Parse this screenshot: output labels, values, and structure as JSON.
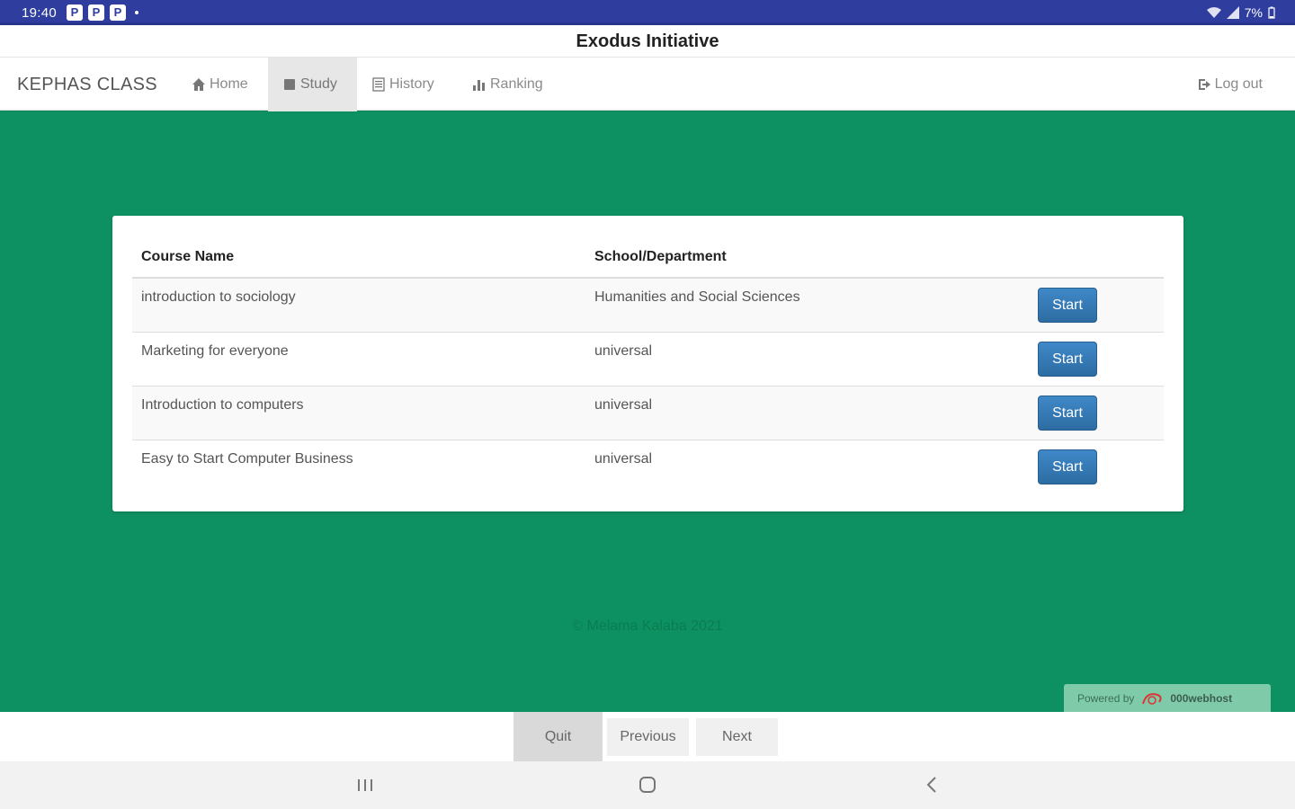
{
  "status_bar": {
    "time": "19:40",
    "badges": [
      "P",
      "P",
      "P"
    ],
    "battery": "7%"
  },
  "app_bar": {
    "title": "Exodus Initiative"
  },
  "navbar": {
    "brand": "KEPHAS CLASS",
    "items": [
      {
        "label": "Home",
        "icon": "home-icon"
      },
      {
        "label": "Study",
        "icon": "book-icon",
        "active": true
      },
      {
        "label": "History",
        "icon": "list-icon"
      },
      {
        "label": "Ranking",
        "icon": "bar-chart-icon"
      }
    ],
    "logout": {
      "label": "Log out",
      "icon": "logout-icon"
    }
  },
  "courses_table": {
    "headers": [
      "Course Name",
      "School/Department"
    ],
    "rows": [
      {
        "course": "introduction to sociology",
        "department": "Humanities and Social Sciences",
        "action": "Start"
      },
      {
        "course": "Marketing for everyone",
        "department": "universal",
        "action": "Start"
      },
      {
        "course": "Introduction to computers",
        "department": "universal",
        "action": "Start"
      },
      {
        "course": "Easy to Start Computer Business",
        "department": "universal",
        "action": "Start"
      }
    ]
  },
  "footer": {
    "copyright": "© Melama Kalaba 2021"
  },
  "powered_by": {
    "label": "Powered by",
    "brand": "000webhost"
  },
  "action_bar": {
    "quit": "Quit",
    "previous": "Previous",
    "next": "Next"
  },
  "colors": {
    "page_bg": "#0e9162",
    "status_bar": "#2f3e9e",
    "primary_button": "#337ab7"
  }
}
